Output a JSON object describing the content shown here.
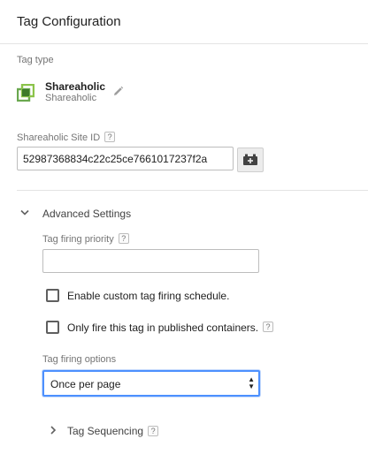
{
  "header": {
    "title": "Tag Configuration"
  },
  "tag_type": {
    "label": "Tag type",
    "name": "Shareaholic",
    "subtitle": "Shareaholic",
    "logo_icon": "shareaholic-logo",
    "logo_color": "#6aa84f",
    "edit_icon": "pencil-icon"
  },
  "site_id": {
    "label": "Shareaholic Site ID",
    "help": "?",
    "value": "52987368834c22c25ce7661017237f2a",
    "variable_button_icon": "variable-brick-icon"
  },
  "advanced": {
    "label": "Advanced Settings",
    "expanded": true,
    "priority_label": "Tag firing priority",
    "priority_help": "?",
    "priority_value": "",
    "schedule_checkbox_label": "Enable custom tag firing schedule.",
    "published_checkbox_label": "Only fire this tag in published containers.",
    "published_help": "?",
    "firing_options_label": "Tag firing options",
    "firing_option_selected": "Once per page",
    "sequencing_label": "Tag Sequencing",
    "sequencing_help": "?"
  },
  "colors": {
    "focus_blue": "#4d90fe",
    "text": "#212121",
    "muted": "#757575"
  }
}
